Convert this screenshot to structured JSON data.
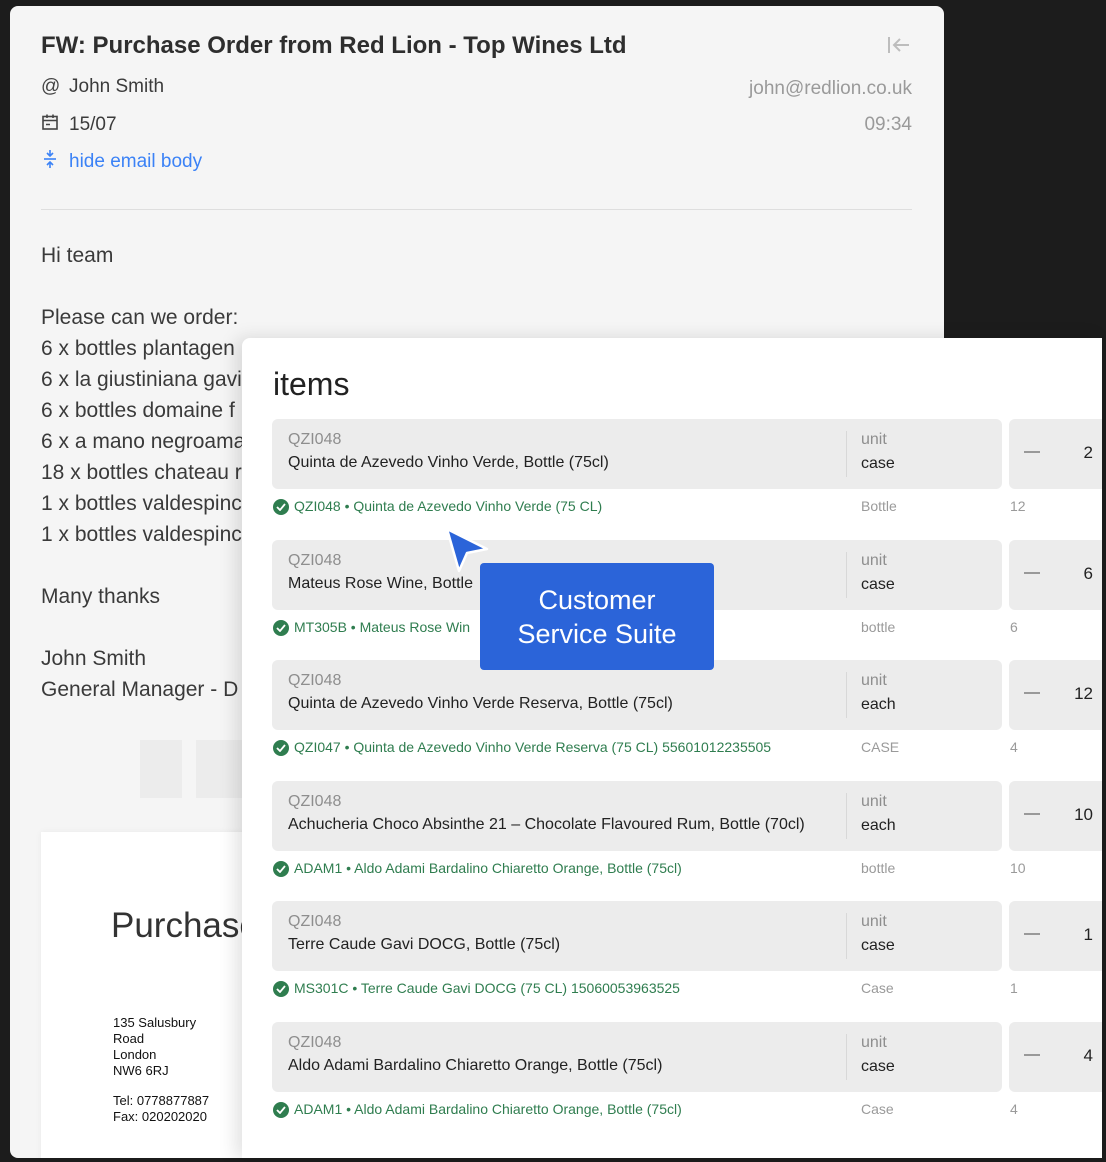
{
  "email": {
    "subject": "FW: Purchase Order from Red Lion - Top Wines Ltd",
    "sender_name": "John Smith",
    "sender_email": "john@redlion.co.uk",
    "date": "15/07",
    "time": "09:34",
    "hide_body_label": "hide email body",
    "body_lines": [
      "Hi team",
      "",
      "Please can we order:",
      "6 x bottles plantagen",
      "6 x la giustiniana gavi",
      "6 x bottles domaine f",
      "6 x a mano negroama",
      "18 x bottles chateau r",
      "1 x bottles valdespinc",
      "1 x bottles valdespinc",
      "",
      "Many thanks",
      "",
      "John Smith",
      "General Manager - D"
    ],
    "attachment": {
      "title": "Purchase",
      "address_lines": [
        "135 Salusbury",
        "Road",
        "London",
        "NW6 6RJ"
      ],
      "tel": "Tel: 0778877887",
      "fax": "Fax: 020202020"
    }
  },
  "items_panel": {
    "title": "items",
    "unit_label": "unit",
    "items": [
      {
        "code": "QZI048",
        "name": "Quinta de Azevedo Vinho Verde, Bottle (75cl)",
        "unit": "case",
        "qty": "2",
        "match": "QZI048 • Quinta de Azevedo Vinho Verde (75 CL)",
        "match_unit": "Bottle",
        "match_qty": "12"
      },
      {
        "code": "QZI048",
        "name": "Mateus Rose Wine, Bottle",
        "unit": "case",
        "qty": "6",
        "match": "MT305B • Mateus Rose Win",
        "match_unit": "bottle",
        "match_qty": "6"
      },
      {
        "code": "QZI048",
        "name": "Quinta de Azevedo Vinho Verde Reserva, Bottle (75cl)",
        "unit": "each",
        "qty": "12",
        "match": "QZI047 • Quinta de Azevedo Vinho Verde Reserva (75 CL) 55601012235505",
        "match_unit": "CASE",
        "match_qty": "4"
      },
      {
        "code": "QZI048",
        "name": "Achucheria Choco Absinthe 21 – Chocolate Flavoured Rum, Bottle (70cl)",
        "unit": "each",
        "qty": "10",
        "match": "ADAM1 • Aldo Adami Bardalino Chiaretto Orange, Bottle (75cl)",
        "match_unit": "bottle",
        "match_qty": "10"
      },
      {
        "code": "QZI048",
        "name": "Terre Caude Gavi DOCG, Bottle (75cl)",
        "unit": "case",
        "qty": "1",
        "match": "MS301C • Terre Caude Gavi DOCG (75 CL) 15060053963525",
        "match_unit": "Case",
        "match_qty": "1"
      },
      {
        "code": "QZI048",
        "name": "Aldo Adami Bardalino Chiaretto Orange, Bottle (75cl)",
        "unit": "case",
        "qty": "4",
        "match": "ADAM1 • Aldo Adami Bardalino Chiaretto Orange, Bottle (75cl)",
        "match_unit": "Case",
        "match_qty": "4"
      }
    ]
  },
  "overlay_label": "Customer Service Suite",
  "colors": {
    "accent_blue": "#2b64d9",
    "link_blue": "#3b82f6",
    "match_green": "#2f7d4f"
  },
  "icons": [
    "collapse-panel-icon",
    "at-icon",
    "calendar-icon",
    "unfold-icon",
    "check-circle-icon",
    "minus-icon",
    "cursor-pointer-icon"
  ]
}
